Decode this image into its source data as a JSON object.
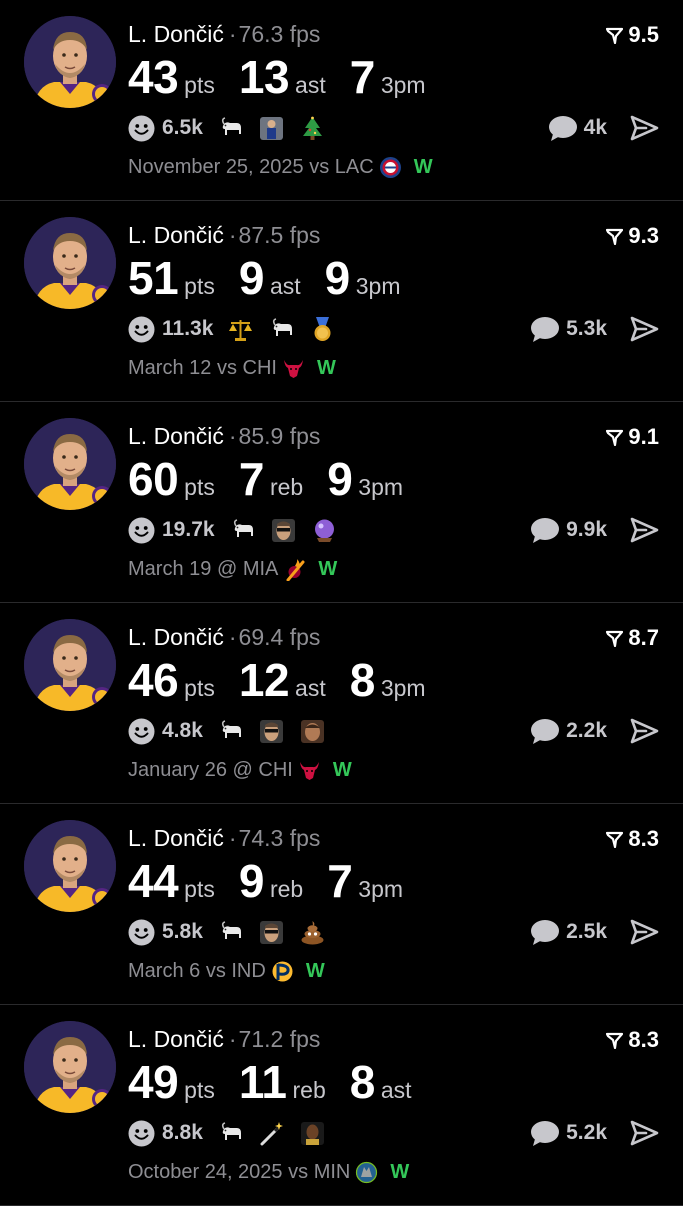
{
  "feed": [
    {
      "player": "L. Dončić",
      "separator": "·",
      "fps": "76.3",
      "fps_unit": "fps",
      "score": "9.5",
      "stats": [
        {
          "value": "43",
          "unit": "pts"
        },
        {
          "value": "13",
          "unit": "ast"
        },
        {
          "value": "7",
          "unit": "3pm"
        }
      ],
      "reactions": "6.5k",
      "emojis": [
        "goat-emoji",
        "player-photo-emoji",
        "christmas-tree-emoji"
      ],
      "comments": "4k",
      "date": "November 25, 2025",
      "venue": "vs",
      "opponent": "LAC",
      "team_logo": "clippers-logo",
      "result": "W"
    },
    {
      "player": "L. Dončić",
      "separator": "·",
      "fps": "87.5",
      "fps_unit": "fps",
      "score": "9.3",
      "stats": [
        {
          "value": "51",
          "unit": "pts"
        },
        {
          "value": "9",
          "unit": "ast"
        },
        {
          "value": "9",
          "unit": "3pm"
        }
      ],
      "reactions": "11.3k",
      "emojis": [
        "scales-emoji",
        "goat-emoji",
        "medal-emoji"
      ],
      "comments": "5.3k",
      "date": "March 12",
      "venue": "vs",
      "opponent": "CHI",
      "team_logo": "bulls-logo",
      "result": "W"
    },
    {
      "player": "L. Dončić",
      "separator": "·",
      "fps": "85.9",
      "fps_unit": "fps",
      "score": "9.1",
      "stats": [
        {
          "value": "60",
          "unit": "pts"
        },
        {
          "value": "7",
          "unit": "reb"
        },
        {
          "value": "9",
          "unit": "3pm"
        }
      ],
      "reactions": "19.7k",
      "emojis": [
        "goat-emoji",
        "player-sunglasses-emoji",
        "crystal-ball-emoji"
      ],
      "comments": "9.9k",
      "date": "March 19",
      "venue": "@",
      "opponent": "MIA",
      "team_logo": "heat-logo",
      "result": "W"
    },
    {
      "player": "L. Dončić",
      "separator": "·",
      "fps": "69.4",
      "fps_unit": "fps",
      "score": "8.7",
      "stats": [
        {
          "value": "46",
          "unit": "pts"
        },
        {
          "value": "12",
          "unit": "ast"
        },
        {
          "value": "8",
          "unit": "3pm"
        }
      ],
      "reactions": "4.8k",
      "emojis": [
        "goat-emoji",
        "player-sunglasses-emoji",
        "player-face-emoji"
      ],
      "comments": "2.2k",
      "date": "January 26",
      "venue": "@",
      "opponent": "CHI",
      "team_logo": "bulls-logo",
      "result": "W"
    },
    {
      "player": "L. Dončić",
      "separator": "·",
      "fps": "74.3",
      "fps_unit": "fps",
      "score": "8.3",
      "stats": [
        {
          "value": "44",
          "unit": "pts"
        },
        {
          "value": "9",
          "unit": "reb"
        },
        {
          "value": "7",
          "unit": "3pm"
        }
      ],
      "reactions": "5.8k",
      "emojis": [
        "goat-emoji",
        "player-sunglasses-emoji",
        "poop-emoji"
      ],
      "comments": "2.5k",
      "date": "March 6",
      "venue": "vs",
      "opponent": "IND",
      "team_logo": "pacers-logo",
      "result": "W"
    },
    {
      "player": "L. Dončić",
      "separator": "·",
      "fps": "71.2",
      "fps_unit": "fps",
      "score": "8.3",
      "stats": [
        {
          "value": "49",
          "unit": "pts"
        },
        {
          "value": "11",
          "unit": "reb"
        },
        {
          "value": "8",
          "unit": "ast"
        }
      ],
      "reactions": "8.8k",
      "emojis": [
        "goat-emoji",
        "magic-wand-emoji",
        "player-dark-emoji"
      ],
      "comments": "5.2k",
      "date": "October 24, 2025",
      "venue": "vs",
      "opponent": "MIN",
      "team_logo": "timberwolves-logo",
      "result": "W"
    }
  ],
  "colors": {
    "background": "#000000",
    "divider": "#2a2a2c",
    "muted_text": "#8e8e93",
    "secondary_text": "#c7c7cc",
    "win_green": "#34c759",
    "lakers_gold": "#f7b928",
    "lakers_purple": "#552583"
  }
}
